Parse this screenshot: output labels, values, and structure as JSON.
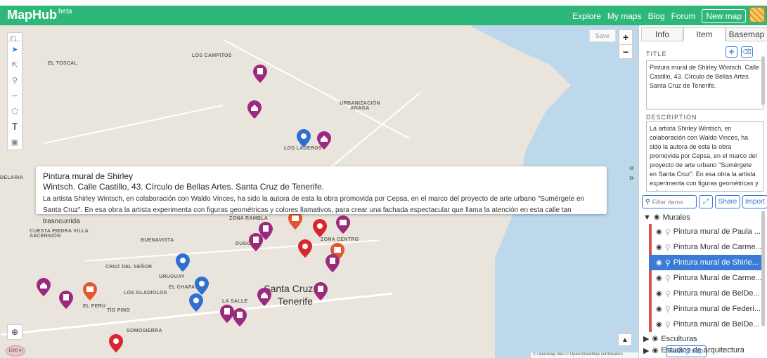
{
  "app": {
    "logo": "MapHub",
    "beta": "beta"
  },
  "nav": {
    "explore": "Explore",
    "my_maps": "My maps",
    "blog": "Blog",
    "forum": "Forum",
    "new_map": "New map"
  },
  "map": {
    "save_label": "Save",
    "labels": {
      "toscal": "EL TOSCAL",
      "campitos": "LOS CAMPITOS",
      "anaga": "URBANIZACIÓN ANAGA",
      "laderas": "LOS LADEROS",
      "uruguay": "URUGUAY",
      "rambla": "ZONA RAMBLA",
      "cuesta": "CUESTA PIEDRA VILLA ASCENSIÓN",
      "buenavista": "BUENAVISTA",
      "peru": "EL PERÚ",
      "cruz": "CRUZ DEL SEÑOR",
      "gladiolos": "LOS GLADIOLOS",
      "chapatal": "EL CHAPATAL",
      "salle": "LA SALLE",
      "tio_pino": "TÍO PINO",
      "somosierra": "SOMOSIERRA",
      "centro": "ZONA CENTRO",
      "duggi": "DUGGI",
      "delaria": "DELARIA"
    },
    "city": "Santa Cruz de Tenerife",
    "attribution": "© OpenMapTiles © OpenStreetMap contributors",
    "scale_label": "1000 m"
  },
  "popup": {
    "title_line1": "Pintura mural de Shirley",
    "title_line2": "Wintsch. Calle Castillo, 43. Círculo de Bellas Artes. Santa Cruz de Tenerife.",
    "description": "La artista Shirley Wintsch, en colaboración con Waldo Vinces, ha sido la autora de esta la obra promovida por Cepsa, en el marco del proyecto de arte urbano \"Sumérgete en Santa Cruz\". En esa obra la artista experimenta con figuras geométricas y colores llamativos, para crear una fachada espectacular que llama la atención en esta calle tan trasncurrida"
  },
  "panel": {
    "tabs": [
      "Info",
      "Item",
      "Basemap"
    ],
    "title_label": "TITLE",
    "title_value": "Pintura mural de Shirley Wintsch. Calle Castillo, 43. Círculo de Bellas Artes. Santa Cruz de Tenerife.",
    "description_label": "DESCRIPTION",
    "description_value": "La artista Shirley Wintsch, en colaboración con Waldo Vinces, ha sido la autora de esta la obra promovida por Cepsa, en el marco del proyecto de arte urbano \"Sumérgete en Santa Cruz\". En esa obra la artista experimenta con figuras geométricas y colores",
    "filter_placeholder": "Filter items",
    "share": "Share",
    "import": "Import",
    "groups": [
      {
        "name": "Murales",
        "expanded": true
      },
      {
        "name": "Esculturas",
        "expanded": false
      },
      {
        "name": "Estudios de arquitectura",
        "expanded": false
      }
    ],
    "items": [
      "Pintura mural de Paula ...",
      "Pintura Mural de Carme...",
      "Pintura mural de Shirle...",
      "Pintura Mural de Carme...",
      "Pintura mural de BelDe...",
      "Pintura mural de Federi...",
      "Pintura mural de BelDe..."
    ],
    "selected_index": 2,
    "new_group": "New group"
  },
  "colors": {
    "brand": "#2db87a",
    "accent": "#3a7bd5",
    "marker_red": "#d9272e",
    "marker_purple": "#9b2a7e",
    "marker_blue": "#2f6fd1",
    "marker_orange": "#e4572e"
  }
}
